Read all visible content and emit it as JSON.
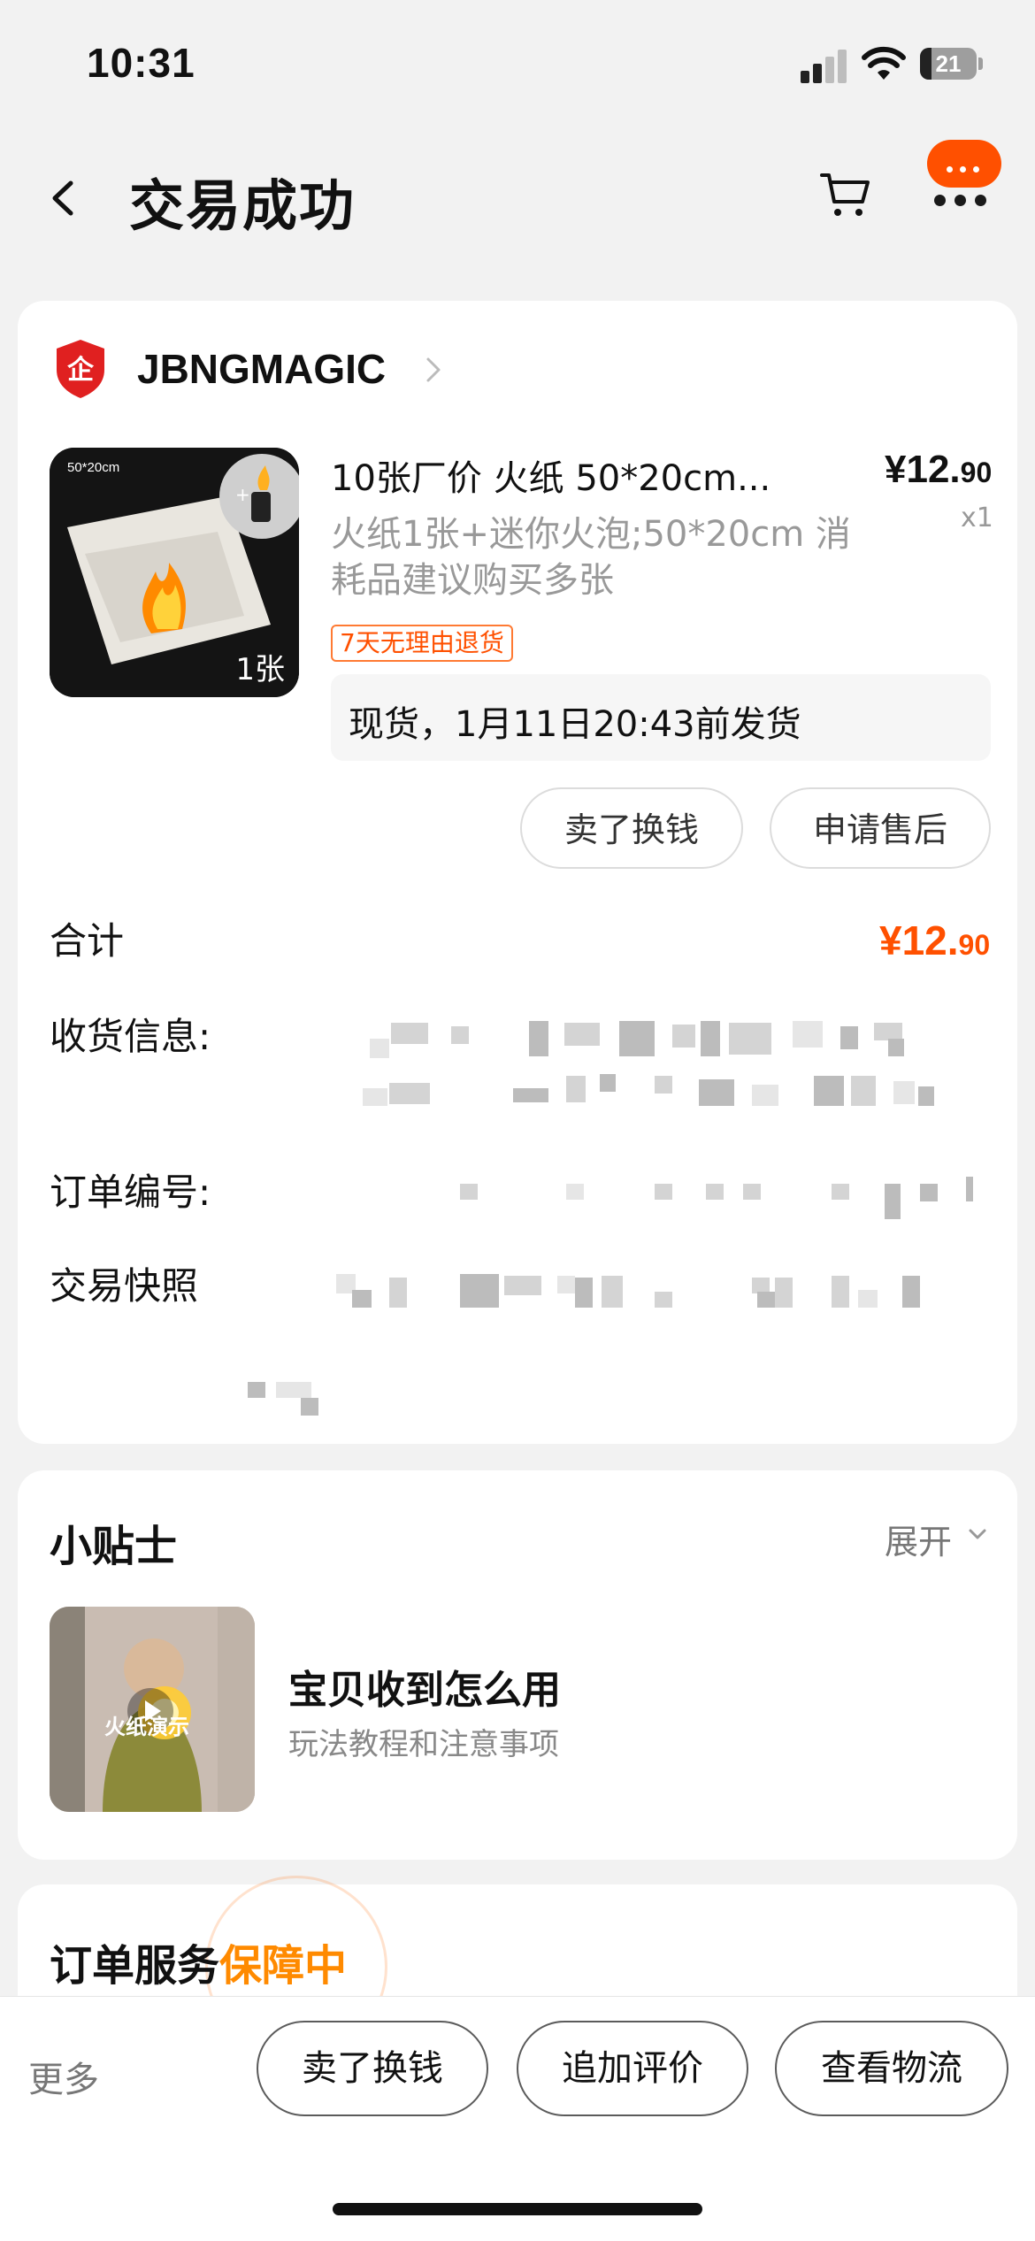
{
  "status_bar": {
    "time": "10:31",
    "battery": "21",
    "battery_level_percent": 21
  },
  "nav": {
    "title": "交易成功",
    "back_icon": "chevron-left-icon",
    "cart_icon": "cart-icon",
    "more_icon": "more-dots-icon"
  },
  "order": {
    "shop_name": "JBNGMAGIC",
    "product": {
      "title": "10张厂价 火纸 50*20cm...",
      "price_main": "¥12.",
      "price_cents": "90",
      "quantity": "x1",
      "sku": "火纸1张+迷你火泡;50*20cm 消耗品建议购买多张",
      "return_tag": "7天无理由退货",
      "thumb_size_label": "50*20cm",
      "thumb_count_label": "1张"
    },
    "shipping_note": "现货，1月11日20:43前发货",
    "actions": {
      "sell": "卖了换钱",
      "after_sale": "申请售后"
    },
    "total_label": "合计",
    "total_main": "¥12.",
    "total_cents": "90",
    "receiver_label": "收货信息:",
    "order_no_label": "订单编号:",
    "snapshot_label": "交易快照"
  },
  "tips": {
    "title": "小贴士",
    "expand": "展开",
    "video_caption": "火纸演示",
    "headline": "宝贝收到怎么用",
    "subline": "玩法教程和注意事项"
  },
  "services": {
    "title_prefix": "订单服务",
    "title_accent": "保障中"
  },
  "bottom_bar": {
    "more": "更多",
    "sell": "卖了换钱",
    "review": "追加评价",
    "logistics": "查看物流"
  },
  "colors": {
    "accent": "#ff5000",
    "guarantee": "#ff8a00",
    "page_bg": "#f2f2f2"
  }
}
